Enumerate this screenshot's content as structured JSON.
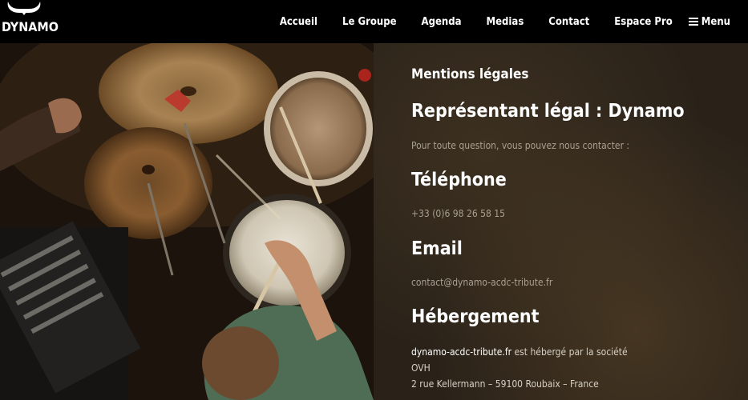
{
  "header": {
    "logo_text": "DYNAMO",
    "nav": [
      {
        "label": "Accueil"
      },
      {
        "label": "Le Groupe"
      },
      {
        "label": "Agenda"
      },
      {
        "label": "Medias"
      },
      {
        "label": "Contact"
      },
      {
        "label": "Espace Pro"
      }
    ],
    "menu_label": "Menu"
  },
  "content": {
    "page_title": "Mentions légales",
    "legal_heading": "Représentant légal : Dynamo",
    "contact_intro": "Pour toute question, vous pouvez nous contacter :",
    "phone_heading": "Téléphone",
    "phone_value": "+33 (0)6 98 26 58 15",
    "email_heading": "Email",
    "email_value": "contact@dynamo-acdc-tribute.fr",
    "hosting_heading": "Hébergement",
    "hosting_site": "dynamo-acdc-tribute.fr",
    "hosting_text": " est hébergé par la société",
    "hosting_company": "OVH",
    "hosting_address": "2 rue Kellermann – 59100 Roubaix – France"
  },
  "colors": {
    "header_bg": "#000000",
    "panel_bg": "#2a2219",
    "muted_text": "#a8a090",
    "white": "#ffffff"
  }
}
